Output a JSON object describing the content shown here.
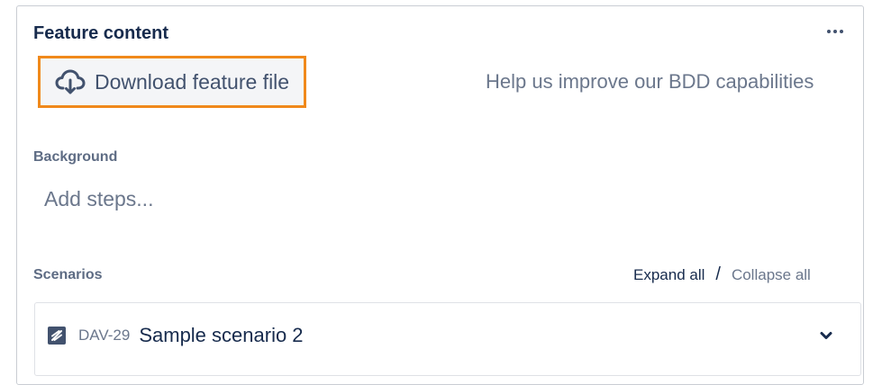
{
  "header": {
    "title": "Feature content"
  },
  "toolbar": {
    "download_label": "Download feature file",
    "help_link": "Help us improve our BDD capabilities"
  },
  "background": {
    "label": "Background",
    "placeholder": "Add steps..."
  },
  "scenarios": {
    "label": "Scenarios",
    "expand_all": "Expand all",
    "separator": "/",
    "collapse_all": "Collapse all",
    "items": [
      {
        "key": "DAV-29",
        "name": "Sample scenario 2",
        "icon": "scenario-icon"
      }
    ]
  },
  "colors": {
    "highlight": "#f0891b",
    "icon": "#42526e"
  }
}
